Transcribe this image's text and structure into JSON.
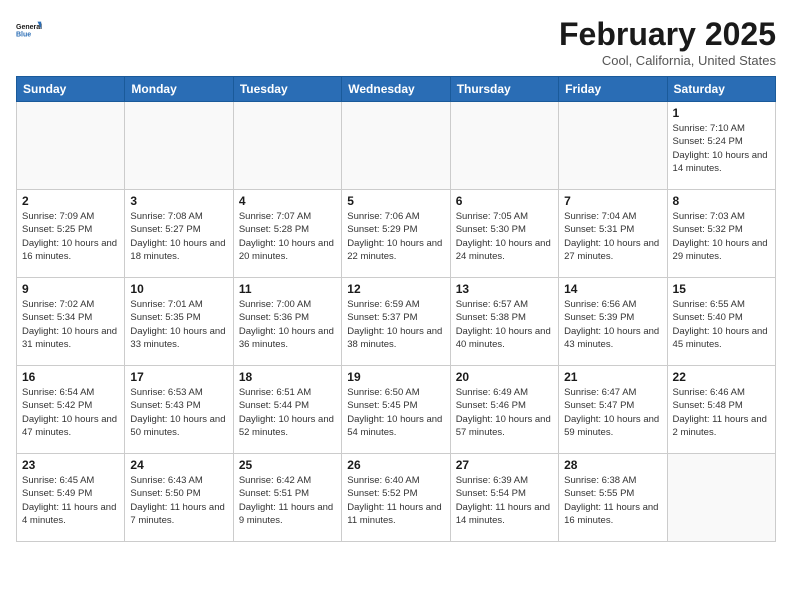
{
  "header": {
    "logo_line1": "General",
    "logo_line2": "Blue",
    "month": "February 2025",
    "location": "Cool, California, United States"
  },
  "weekdays": [
    "Sunday",
    "Monday",
    "Tuesday",
    "Wednesday",
    "Thursday",
    "Friday",
    "Saturday"
  ],
  "weeks": [
    [
      {
        "day": "",
        "info": ""
      },
      {
        "day": "",
        "info": ""
      },
      {
        "day": "",
        "info": ""
      },
      {
        "day": "",
        "info": ""
      },
      {
        "day": "",
        "info": ""
      },
      {
        "day": "",
        "info": ""
      },
      {
        "day": "1",
        "info": "Sunrise: 7:10 AM\nSunset: 5:24 PM\nDaylight: 10 hours\nand 14 minutes."
      }
    ],
    [
      {
        "day": "2",
        "info": "Sunrise: 7:09 AM\nSunset: 5:25 PM\nDaylight: 10 hours\nand 16 minutes."
      },
      {
        "day": "3",
        "info": "Sunrise: 7:08 AM\nSunset: 5:27 PM\nDaylight: 10 hours\nand 18 minutes."
      },
      {
        "day": "4",
        "info": "Sunrise: 7:07 AM\nSunset: 5:28 PM\nDaylight: 10 hours\nand 20 minutes."
      },
      {
        "day": "5",
        "info": "Sunrise: 7:06 AM\nSunset: 5:29 PM\nDaylight: 10 hours\nand 22 minutes."
      },
      {
        "day": "6",
        "info": "Sunrise: 7:05 AM\nSunset: 5:30 PM\nDaylight: 10 hours\nand 24 minutes."
      },
      {
        "day": "7",
        "info": "Sunrise: 7:04 AM\nSunset: 5:31 PM\nDaylight: 10 hours\nand 27 minutes."
      },
      {
        "day": "8",
        "info": "Sunrise: 7:03 AM\nSunset: 5:32 PM\nDaylight: 10 hours\nand 29 minutes."
      }
    ],
    [
      {
        "day": "9",
        "info": "Sunrise: 7:02 AM\nSunset: 5:34 PM\nDaylight: 10 hours\nand 31 minutes."
      },
      {
        "day": "10",
        "info": "Sunrise: 7:01 AM\nSunset: 5:35 PM\nDaylight: 10 hours\nand 33 minutes."
      },
      {
        "day": "11",
        "info": "Sunrise: 7:00 AM\nSunset: 5:36 PM\nDaylight: 10 hours\nand 36 minutes."
      },
      {
        "day": "12",
        "info": "Sunrise: 6:59 AM\nSunset: 5:37 PM\nDaylight: 10 hours\nand 38 minutes."
      },
      {
        "day": "13",
        "info": "Sunrise: 6:57 AM\nSunset: 5:38 PM\nDaylight: 10 hours\nand 40 minutes."
      },
      {
        "day": "14",
        "info": "Sunrise: 6:56 AM\nSunset: 5:39 PM\nDaylight: 10 hours\nand 43 minutes."
      },
      {
        "day": "15",
        "info": "Sunrise: 6:55 AM\nSunset: 5:40 PM\nDaylight: 10 hours\nand 45 minutes."
      }
    ],
    [
      {
        "day": "16",
        "info": "Sunrise: 6:54 AM\nSunset: 5:42 PM\nDaylight: 10 hours\nand 47 minutes."
      },
      {
        "day": "17",
        "info": "Sunrise: 6:53 AM\nSunset: 5:43 PM\nDaylight: 10 hours\nand 50 minutes."
      },
      {
        "day": "18",
        "info": "Sunrise: 6:51 AM\nSunset: 5:44 PM\nDaylight: 10 hours\nand 52 minutes."
      },
      {
        "day": "19",
        "info": "Sunrise: 6:50 AM\nSunset: 5:45 PM\nDaylight: 10 hours\nand 54 minutes."
      },
      {
        "day": "20",
        "info": "Sunrise: 6:49 AM\nSunset: 5:46 PM\nDaylight: 10 hours\nand 57 minutes."
      },
      {
        "day": "21",
        "info": "Sunrise: 6:47 AM\nSunset: 5:47 PM\nDaylight: 10 hours\nand 59 minutes."
      },
      {
        "day": "22",
        "info": "Sunrise: 6:46 AM\nSunset: 5:48 PM\nDaylight: 11 hours\nand 2 minutes."
      }
    ],
    [
      {
        "day": "23",
        "info": "Sunrise: 6:45 AM\nSunset: 5:49 PM\nDaylight: 11 hours\nand 4 minutes."
      },
      {
        "day": "24",
        "info": "Sunrise: 6:43 AM\nSunset: 5:50 PM\nDaylight: 11 hours\nand 7 minutes."
      },
      {
        "day": "25",
        "info": "Sunrise: 6:42 AM\nSunset: 5:51 PM\nDaylight: 11 hours\nand 9 minutes."
      },
      {
        "day": "26",
        "info": "Sunrise: 6:40 AM\nSunset: 5:52 PM\nDaylight: 11 hours\nand 11 minutes."
      },
      {
        "day": "27",
        "info": "Sunrise: 6:39 AM\nSunset: 5:54 PM\nDaylight: 11 hours\nand 14 minutes."
      },
      {
        "day": "28",
        "info": "Sunrise: 6:38 AM\nSunset: 5:55 PM\nDaylight: 11 hours\nand 16 minutes."
      },
      {
        "day": "",
        "info": ""
      }
    ]
  ]
}
